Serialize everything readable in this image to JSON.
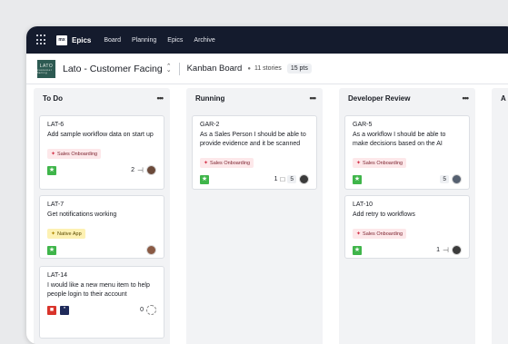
{
  "topbar": {
    "logo": "mx",
    "brand": "Epics",
    "nav": [
      "Board",
      "Planning",
      "Epics",
      "Archive"
    ]
  },
  "header": {
    "project_logo_line1": "LATO",
    "project_logo_line2": "customer facing",
    "project_title": "Lato - Customer Facing",
    "view_title": "Kanban Board",
    "stories": "11 stories",
    "points": "15 pts"
  },
  "columns": [
    {
      "title": "To Do",
      "menu": "•••",
      "cards": [
        {
          "key": "LAT-6",
          "title": "Add sample workflow data on start up",
          "label": "Sales Onboarding",
          "count": "2",
          "points": ""
        },
        {
          "key": "LAT-7",
          "title": "Get notifications working",
          "label": "Native App",
          "count": "",
          "points": ""
        },
        {
          "key": "LAT-14",
          "title": "I would like a new menu item to help people login to their account",
          "label": "",
          "count": "0",
          "points": ""
        }
      ]
    },
    {
      "title": "Running",
      "menu": "•••",
      "cards": [
        {
          "key": "GAR-2",
          "title": "As a Sales Person I should be able to provide evidence and it be scanned",
          "label": "Sales Onboarding",
          "count": "1",
          "points": "5"
        }
      ]
    },
    {
      "title": "Developer Review",
      "menu": "•••",
      "cards": [
        {
          "key": "GAR-5",
          "title": "As a workflow I should be able to make decisions based on the AI",
          "label": "Sales Onboarding",
          "count": "",
          "points": "5"
        },
        {
          "key": "LAT-10",
          "title": "Add retry to workflows",
          "label": "Sales Onboarding",
          "count": "1",
          "points": ""
        }
      ]
    },
    {
      "title": "A",
      "menu": ""
    }
  ],
  "icons": {
    "apps": "grid-icon",
    "story": "star-icon",
    "subtask": "branch-icon",
    "comment": "comment-icon"
  },
  "colors": {
    "topbar": "#141b2d",
    "story_green": "#3fb54a",
    "sales_label_bg": "#fde8ea",
    "native_label_bg": "#fdf1b3"
  }
}
